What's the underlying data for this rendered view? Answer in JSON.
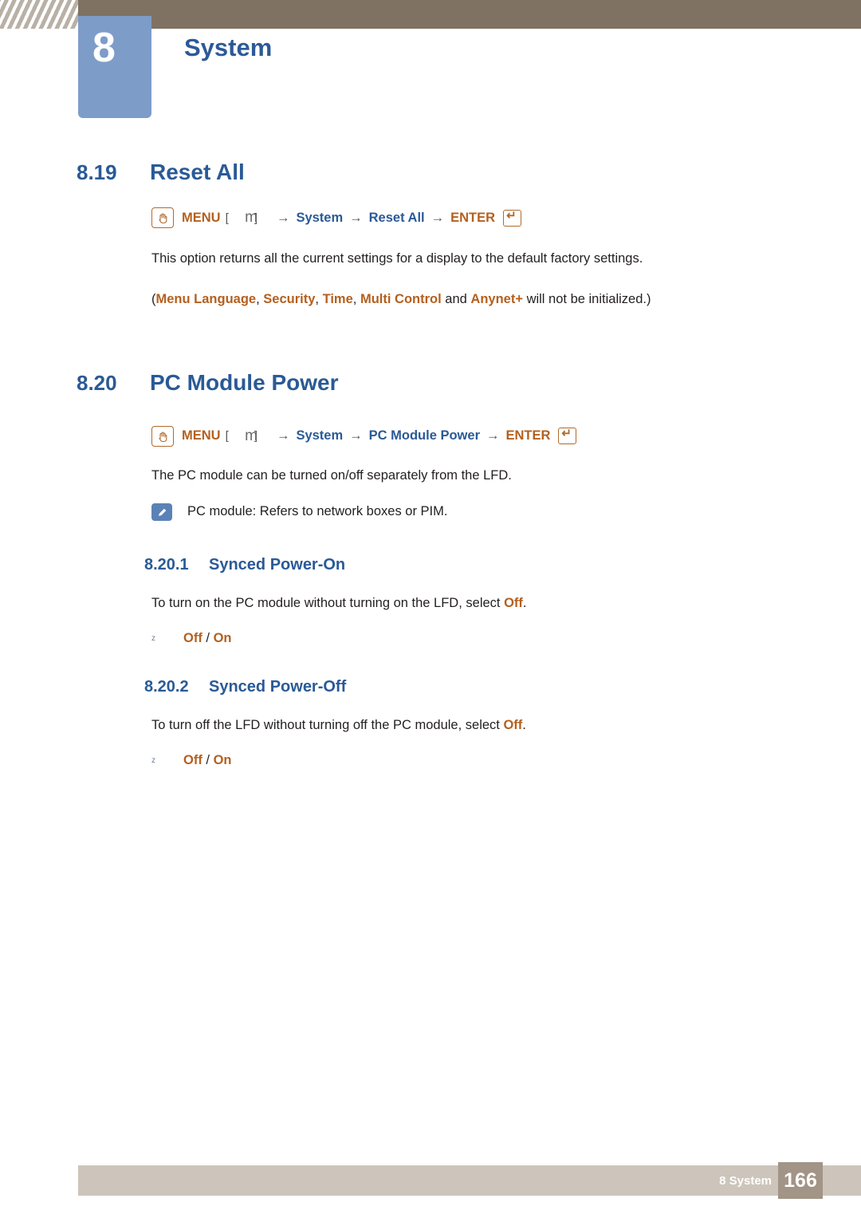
{
  "header": {
    "chapter_number": "8",
    "chapter_title": "System"
  },
  "sections": [
    {
      "number": "8.19",
      "title": "Reset All",
      "menu_path": {
        "menu_label": "MENU",
        "menu_key": "m",
        "steps": [
          "System",
          "Reset All"
        ],
        "enter_label": "ENTER"
      },
      "body": "This option returns all the current settings for a display to the default factory settings.",
      "note_line": {
        "open": "(",
        "items": [
          "Menu Language",
          "Security",
          "Time",
          "Multi Control"
        ],
        "conjunction": "and",
        "last_item": "Anynet+",
        "tail": "will not be initialized.)"
      }
    },
    {
      "number": "8.20",
      "title": "PC Module Power",
      "menu_path": {
        "menu_label": "MENU",
        "menu_key": "m",
        "steps": [
          "System",
          "PC Module Power"
        ],
        "enter_label": "ENTER"
      },
      "body": "The PC module can be turned on/off separately from the LFD.",
      "note": "PC module: Refers to network boxes or PIM.",
      "subsections": [
        {
          "number": "8.20.1",
          "title": "Synced Power-On",
          "body_pre": "To turn on the PC module without turning on the LFD, select ",
          "body_em": "Off",
          "body_post": ".",
          "options": [
            "Off",
            "On"
          ],
          "option_separator": " / "
        },
        {
          "number": "8.20.2",
          "title": "Synced Power-Off",
          "body_pre": "To turn off the LFD without turning off the PC module, select ",
          "body_em": "Off",
          "body_post": ".",
          "options": [
            "Off",
            "On"
          ],
          "option_separator": " / "
        }
      ]
    }
  ],
  "footer": {
    "label": "8 System",
    "page_number": "166"
  },
  "colors": {
    "header_bar": "#7f7263",
    "chapter_tab": "#7e9cc8",
    "heading_blue": "#2a5a96",
    "accent_orange": "#b4601f",
    "footer_bar": "#cdc5bb",
    "page_box": "#a29486"
  }
}
